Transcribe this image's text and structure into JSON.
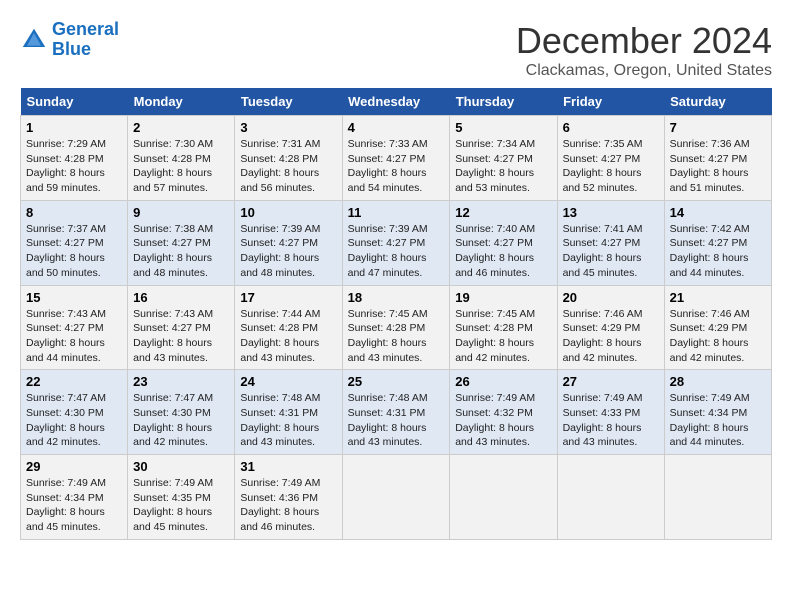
{
  "logo": {
    "line1": "General",
    "line2": "Blue"
  },
  "title": "December 2024",
  "subtitle": "Clackamas, Oregon, United States",
  "weekdays": [
    "Sunday",
    "Monday",
    "Tuesday",
    "Wednesday",
    "Thursday",
    "Friday",
    "Saturday"
  ],
  "weeks": [
    [
      {
        "day": "1",
        "sunrise": "7:29 AM",
        "sunset": "4:28 PM",
        "daylight": "8 hours and 59 minutes."
      },
      {
        "day": "2",
        "sunrise": "7:30 AM",
        "sunset": "4:28 PM",
        "daylight": "8 hours and 57 minutes."
      },
      {
        "day": "3",
        "sunrise": "7:31 AM",
        "sunset": "4:28 PM",
        "daylight": "8 hours and 56 minutes."
      },
      {
        "day": "4",
        "sunrise": "7:33 AM",
        "sunset": "4:27 PM",
        "daylight": "8 hours and 54 minutes."
      },
      {
        "day": "5",
        "sunrise": "7:34 AM",
        "sunset": "4:27 PM",
        "daylight": "8 hours and 53 minutes."
      },
      {
        "day": "6",
        "sunrise": "7:35 AM",
        "sunset": "4:27 PM",
        "daylight": "8 hours and 52 minutes."
      },
      {
        "day": "7",
        "sunrise": "7:36 AM",
        "sunset": "4:27 PM",
        "daylight": "8 hours and 51 minutes."
      }
    ],
    [
      {
        "day": "8",
        "sunrise": "7:37 AM",
        "sunset": "4:27 PM",
        "daylight": "8 hours and 50 minutes."
      },
      {
        "day": "9",
        "sunrise": "7:38 AM",
        "sunset": "4:27 PM",
        "daylight": "8 hours and 48 minutes."
      },
      {
        "day": "10",
        "sunrise": "7:39 AM",
        "sunset": "4:27 PM",
        "daylight": "8 hours and 48 minutes."
      },
      {
        "day": "11",
        "sunrise": "7:39 AM",
        "sunset": "4:27 PM",
        "daylight": "8 hours and 47 minutes."
      },
      {
        "day": "12",
        "sunrise": "7:40 AM",
        "sunset": "4:27 PM",
        "daylight": "8 hours and 46 minutes."
      },
      {
        "day": "13",
        "sunrise": "7:41 AM",
        "sunset": "4:27 PM",
        "daylight": "8 hours and 45 minutes."
      },
      {
        "day": "14",
        "sunrise": "7:42 AM",
        "sunset": "4:27 PM",
        "daylight": "8 hours and 44 minutes."
      }
    ],
    [
      {
        "day": "15",
        "sunrise": "7:43 AM",
        "sunset": "4:27 PM",
        "daylight": "8 hours and 44 minutes."
      },
      {
        "day": "16",
        "sunrise": "7:43 AM",
        "sunset": "4:27 PM",
        "daylight": "8 hours and 43 minutes."
      },
      {
        "day": "17",
        "sunrise": "7:44 AM",
        "sunset": "4:28 PM",
        "daylight": "8 hours and 43 minutes."
      },
      {
        "day": "18",
        "sunrise": "7:45 AM",
        "sunset": "4:28 PM",
        "daylight": "8 hours and 43 minutes."
      },
      {
        "day": "19",
        "sunrise": "7:45 AM",
        "sunset": "4:28 PM",
        "daylight": "8 hours and 42 minutes."
      },
      {
        "day": "20",
        "sunrise": "7:46 AM",
        "sunset": "4:29 PM",
        "daylight": "8 hours and 42 minutes."
      },
      {
        "day": "21",
        "sunrise": "7:46 AM",
        "sunset": "4:29 PM",
        "daylight": "8 hours and 42 minutes."
      }
    ],
    [
      {
        "day": "22",
        "sunrise": "7:47 AM",
        "sunset": "4:30 PM",
        "daylight": "8 hours and 42 minutes."
      },
      {
        "day": "23",
        "sunrise": "7:47 AM",
        "sunset": "4:30 PM",
        "daylight": "8 hours and 42 minutes."
      },
      {
        "day": "24",
        "sunrise": "7:48 AM",
        "sunset": "4:31 PM",
        "daylight": "8 hours and 43 minutes."
      },
      {
        "day": "25",
        "sunrise": "7:48 AM",
        "sunset": "4:31 PM",
        "daylight": "8 hours and 43 minutes."
      },
      {
        "day": "26",
        "sunrise": "7:49 AM",
        "sunset": "4:32 PM",
        "daylight": "8 hours and 43 minutes."
      },
      {
        "day": "27",
        "sunrise": "7:49 AM",
        "sunset": "4:33 PM",
        "daylight": "8 hours and 43 minutes."
      },
      {
        "day": "28",
        "sunrise": "7:49 AM",
        "sunset": "4:34 PM",
        "daylight": "8 hours and 44 minutes."
      }
    ],
    [
      {
        "day": "29",
        "sunrise": "7:49 AM",
        "sunset": "4:34 PM",
        "daylight": "8 hours and 45 minutes."
      },
      {
        "day": "30",
        "sunrise": "7:49 AM",
        "sunset": "4:35 PM",
        "daylight": "8 hours and 45 minutes."
      },
      {
        "day": "31",
        "sunrise": "7:49 AM",
        "sunset": "4:36 PM",
        "daylight": "8 hours and 46 minutes."
      },
      null,
      null,
      null,
      null
    ]
  ]
}
